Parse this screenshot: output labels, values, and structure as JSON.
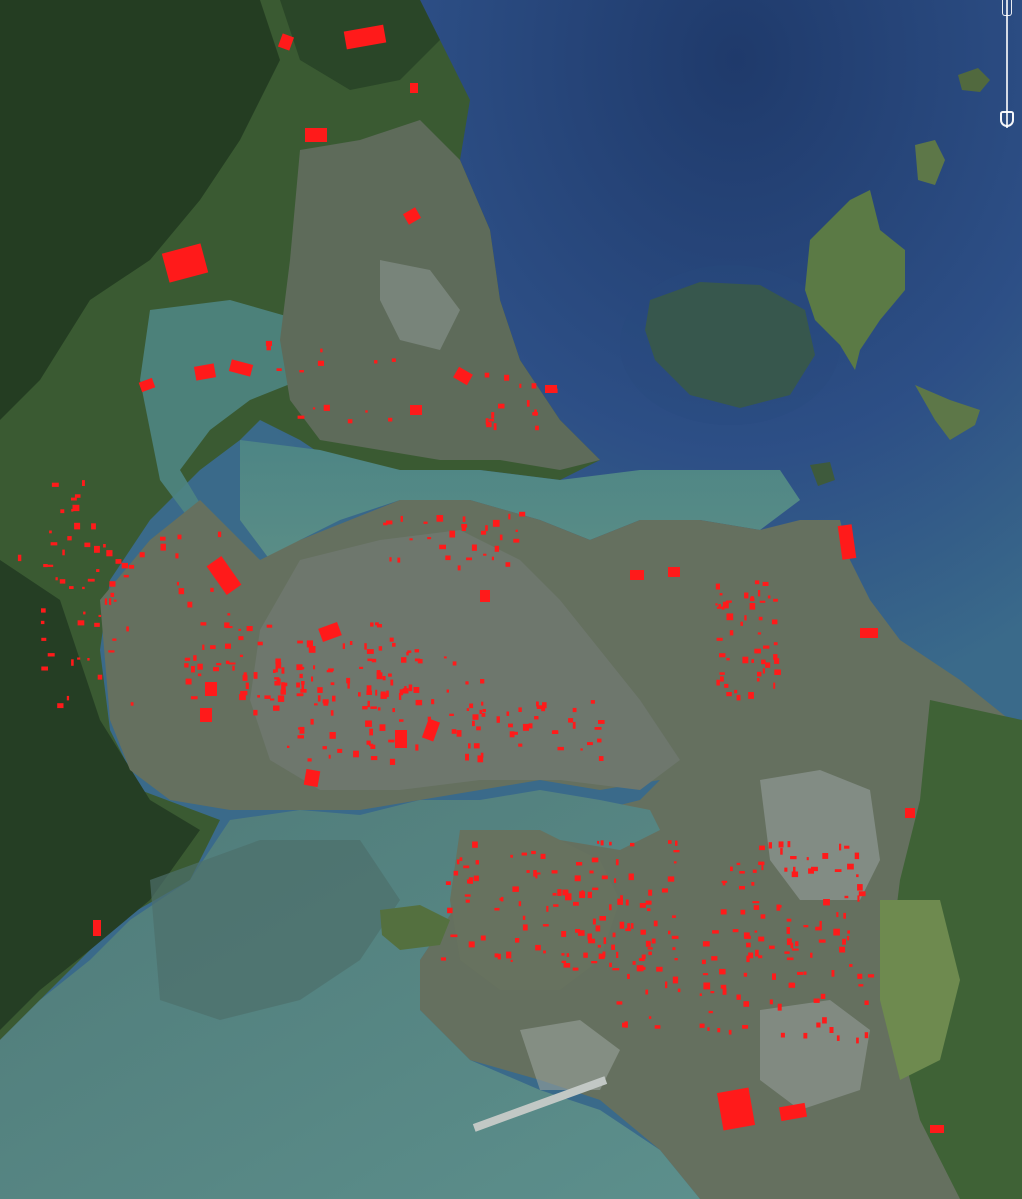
{
  "map": {
    "type": "satellite",
    "overlay_color": "#ff1a1a",
    "colors": {
      "deep_water": "#2a4a7a",
      "shallow_water": "#3e7f86",
      "tidal_flats": "#567c78",
      "forest": "#2f4a2a",
      "farmland": "#5a7a45",
      "urban": "#6a7468",
      "urban_light": "#8d9590",
      "island_green": "#4e6e3c"
    }
  },
  "controls": {
    "zoom_slider": {
      "icon": "zoom-slider-icon",
      "level": 0.9
    }
  }
}
